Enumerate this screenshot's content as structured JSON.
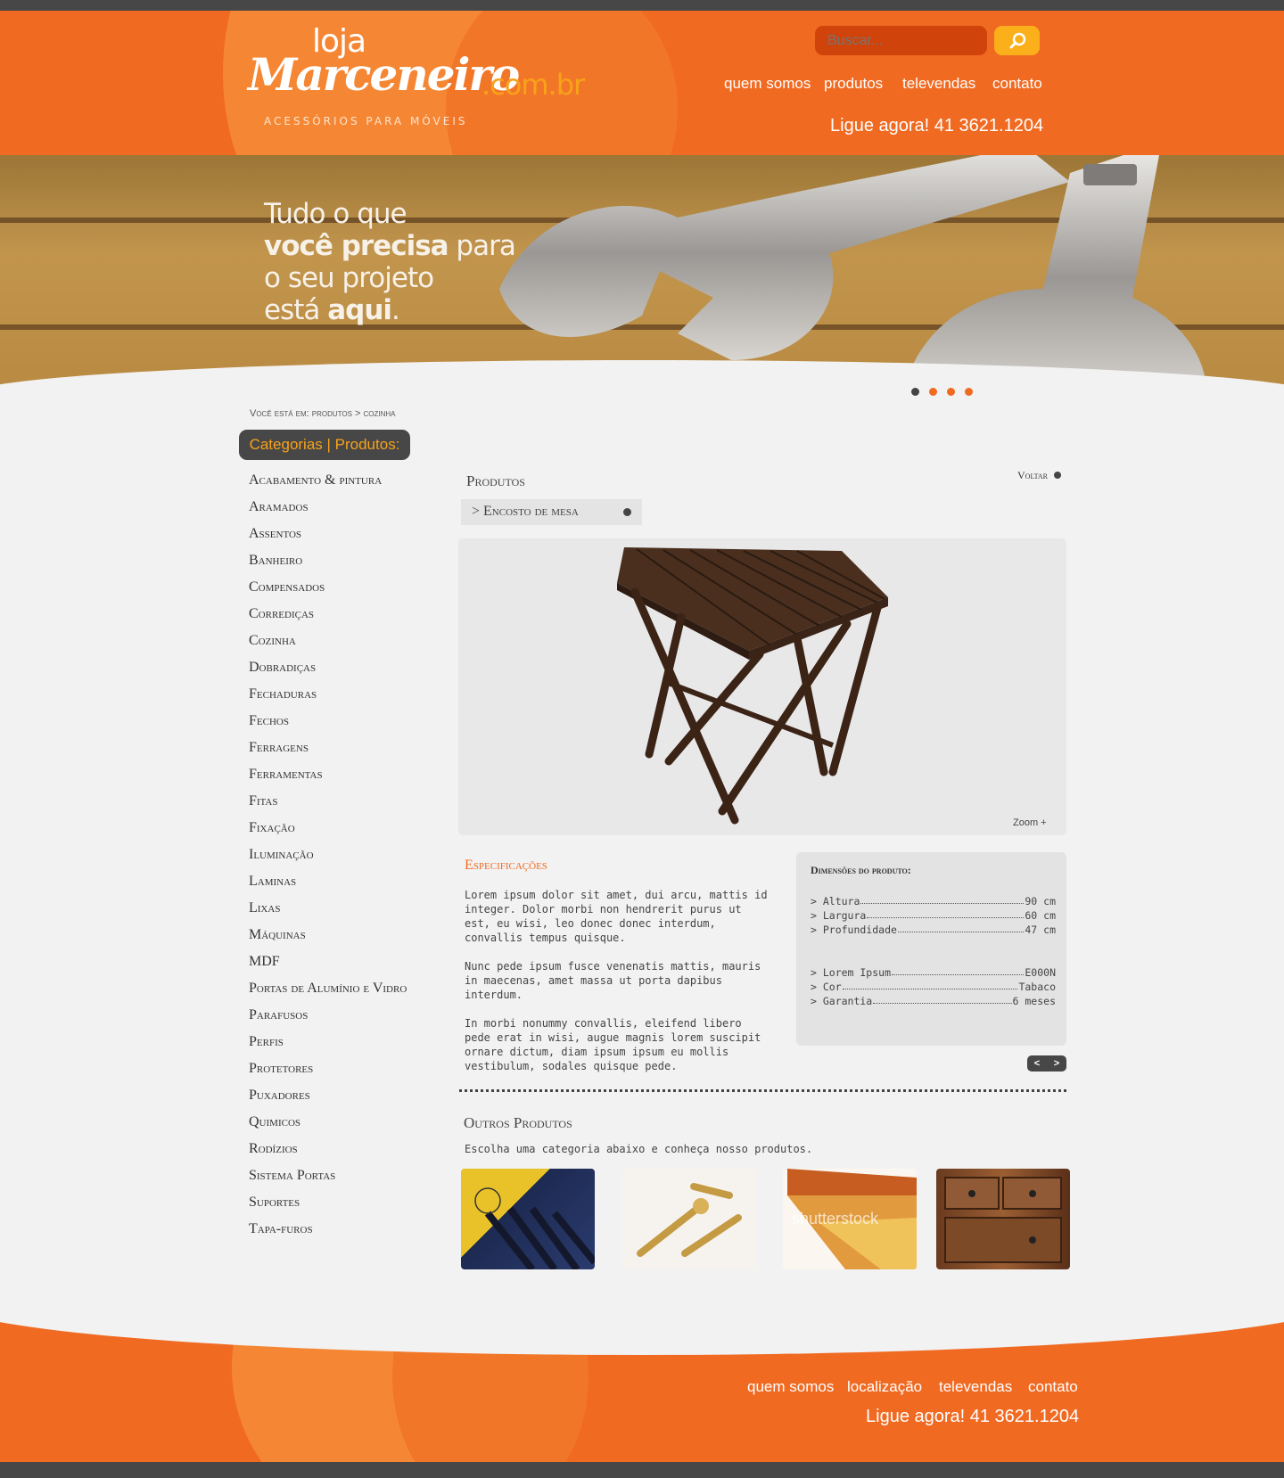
{
  "header": {
    "logo": {
      "loja": "loja",
      "brand": "Marceneiro",
      "domain": ".com.br",
      "tagline": "ACESSÓRIOS PARA MÓVEIS"
    },
    "search": {
      "placeholder": "Buscar..."
    },
    "nav": [
      "quem somos",
      "produtos",
      "televendas",
      "contato"
    ],
    "phone": "Ligue agora! 41 3621.1204"
  },
  "banner": {
    "line1": "Tudo o que",
    "line2_bold": "você precisa",
    "line2_rest": " para",
    "line3": "o seu projeto",
    "line4_pre": "está ",
    "line4_bold": "aqui",
    "line4_post": ".",
    "slides": 4,
    "active_slide": 1
  },
  "breadcrumb": "Você está em: produtos > cozinha",
  "sidebar": {
    "title": "Categorias | Produtos:",
    "items": [
      "Acabamento & pintura",
      "Aramados",
      "Assentos",
      "Banheiro",
      "Compensados",
      "Corrediças",
      "Cozinha",
      "Dobradiças",
      "Fechaduras",
      "Fechos",
      "Ferragens",
      "Ferramentas",
      "Fitas",
      "Fixação",
      "Iluminação",
      "Laminas",
      "Lixas",
      "Máquinas",
      "MDF",
      "Portas de Alumínio e Vidro",
      "Parafusos",
      "Perfis",
      "Protetores",
      "Puxadores",
      "Quimicos",
      "Rodízios",
      "Sistema Portas",
      "Suportes",
      "Tapa-furos"
    ]
  },
  "product": {
    "section_title": "Produtos",
    "back": "Voltar",
    "name": "> Encosto de mesa",
    "zoom": "Zoom +",
    "spec_title": "Especificações",
    "spec_paragraphs": [
      "Lorem ipsum dolor sit amet, dui arcu, mattis id integer. Dolor morbi non hendrerit purus ut est, eu wisi, leo donec donec interdum, convallis tempus quisque.",
      "Nunc pede ipsum fusce venenatis mattis, mauris in maecenas, amet massa ut porta dapibus interdum.",
      "In morbi nonummy convallis, eleifend libero pede erat in wisi, augue magnis lorem suscipit ornare dictum, diam ipsum ipsum eu mollis vestibulum, sodales quisque pede."
    ],
    "dimensions_title": "Dimensões do produto:",
    "dimensions": [
      {
        "label": "> Altura",
        "value": "90 cm"
      },
      {
        "label": "> Largura",
        "value": "60 cm"
      },
      {
        "label": "> Profundidade",
        "value": "47 cm"
      }
    ],
    "details": [
      {
        "label": "> Lorem Ipsum",
        "value": "E000N"
      },
      {
        "label": "> Cor",
        "value": "Tabaco"
      },
      {
        "label": "> Garantia",
        "value": " 6 meses"
      }
    ],
    "pager_prev": "<",
    "pager_next": ">"
  },
  "others": {
    "title": "Outros Produtos",
    "subtitle": "Escolha uma categoria abaixo e conheça nosso produtos.",
    "thumb_watermark": "shutterstock"
  },
  "footer": {
    "nav": [
      "quem somos",
      "localização",
      "televendas",
      "contato"
    ],
    "phone": "Ligue agora! 41 3621.1204"
  },
  "colors": {
    "orange": "#f06a22",
    "dark": "#474747",
    "accent": "#f8a21a"
  }
}
